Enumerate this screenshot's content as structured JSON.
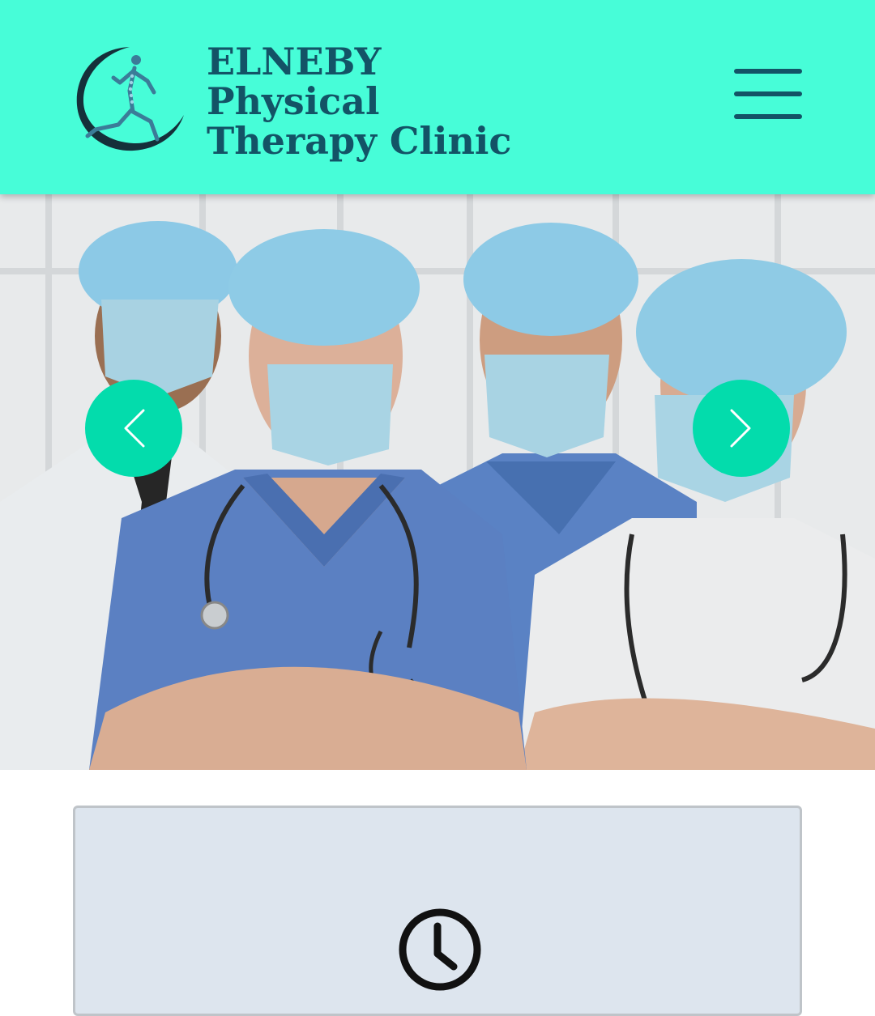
{
  "header": {
    "brand_lines": [
      "ELNEBY",
      "Physical",
      "Therapy Clinic"
    ],
    "logo_icon": "runner-spine-logo",
    "menu_icon": "hamburger-menu-icon",
    "background_color": "#47fdd8",
    "text_color": "#135366"
  },
  "hero": {
    "image_description_icon": "medical-team-photo",
    "prev_icon": "chevron-left-icon",
    "next_icon": "chevron-right-icon",
    "arrow_color": "#03dcac"
  },
  "info_card": {
    "icon": "clock-icon",
    "background_color": "#dde5ee"
  }
}
